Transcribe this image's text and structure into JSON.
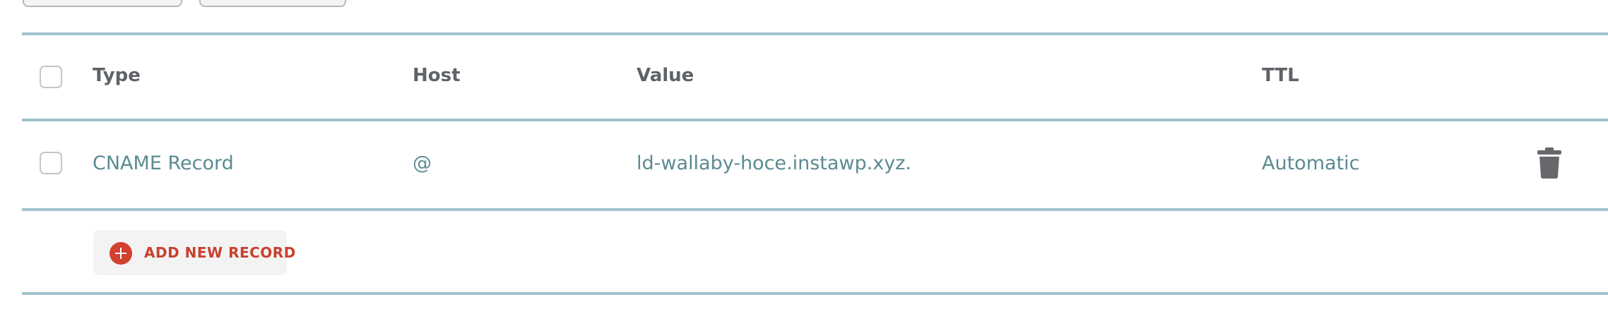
{
  "table": {
    "headers": {
      "type": "Type",
      "host": "Host",
      "value": "Value",
      "ttl": "TTL"
    },
    "rows": [
      {
        "type": "CNAME Record",
        "host": "@",
        "value": "ld-wallaby-hoce.instawp.xyz.",
        "ttl": "Automatic",
        "selected": false
      }
    ],
    "select_all": false
  },
  "actions": {
    "add_new_record_label": "ADD NEW RECORD",
    "delete_icon": "trash-icon",
    "add_icon": "plus-circle-icon"
  },
  "colors": {
    "accent": "#c9402e",
    "row_text": "#5a8b92",
    "header_text": "#5f6367",
    "divider": "#9fc4cc",
    "trash": "#66686b"
  }
}
